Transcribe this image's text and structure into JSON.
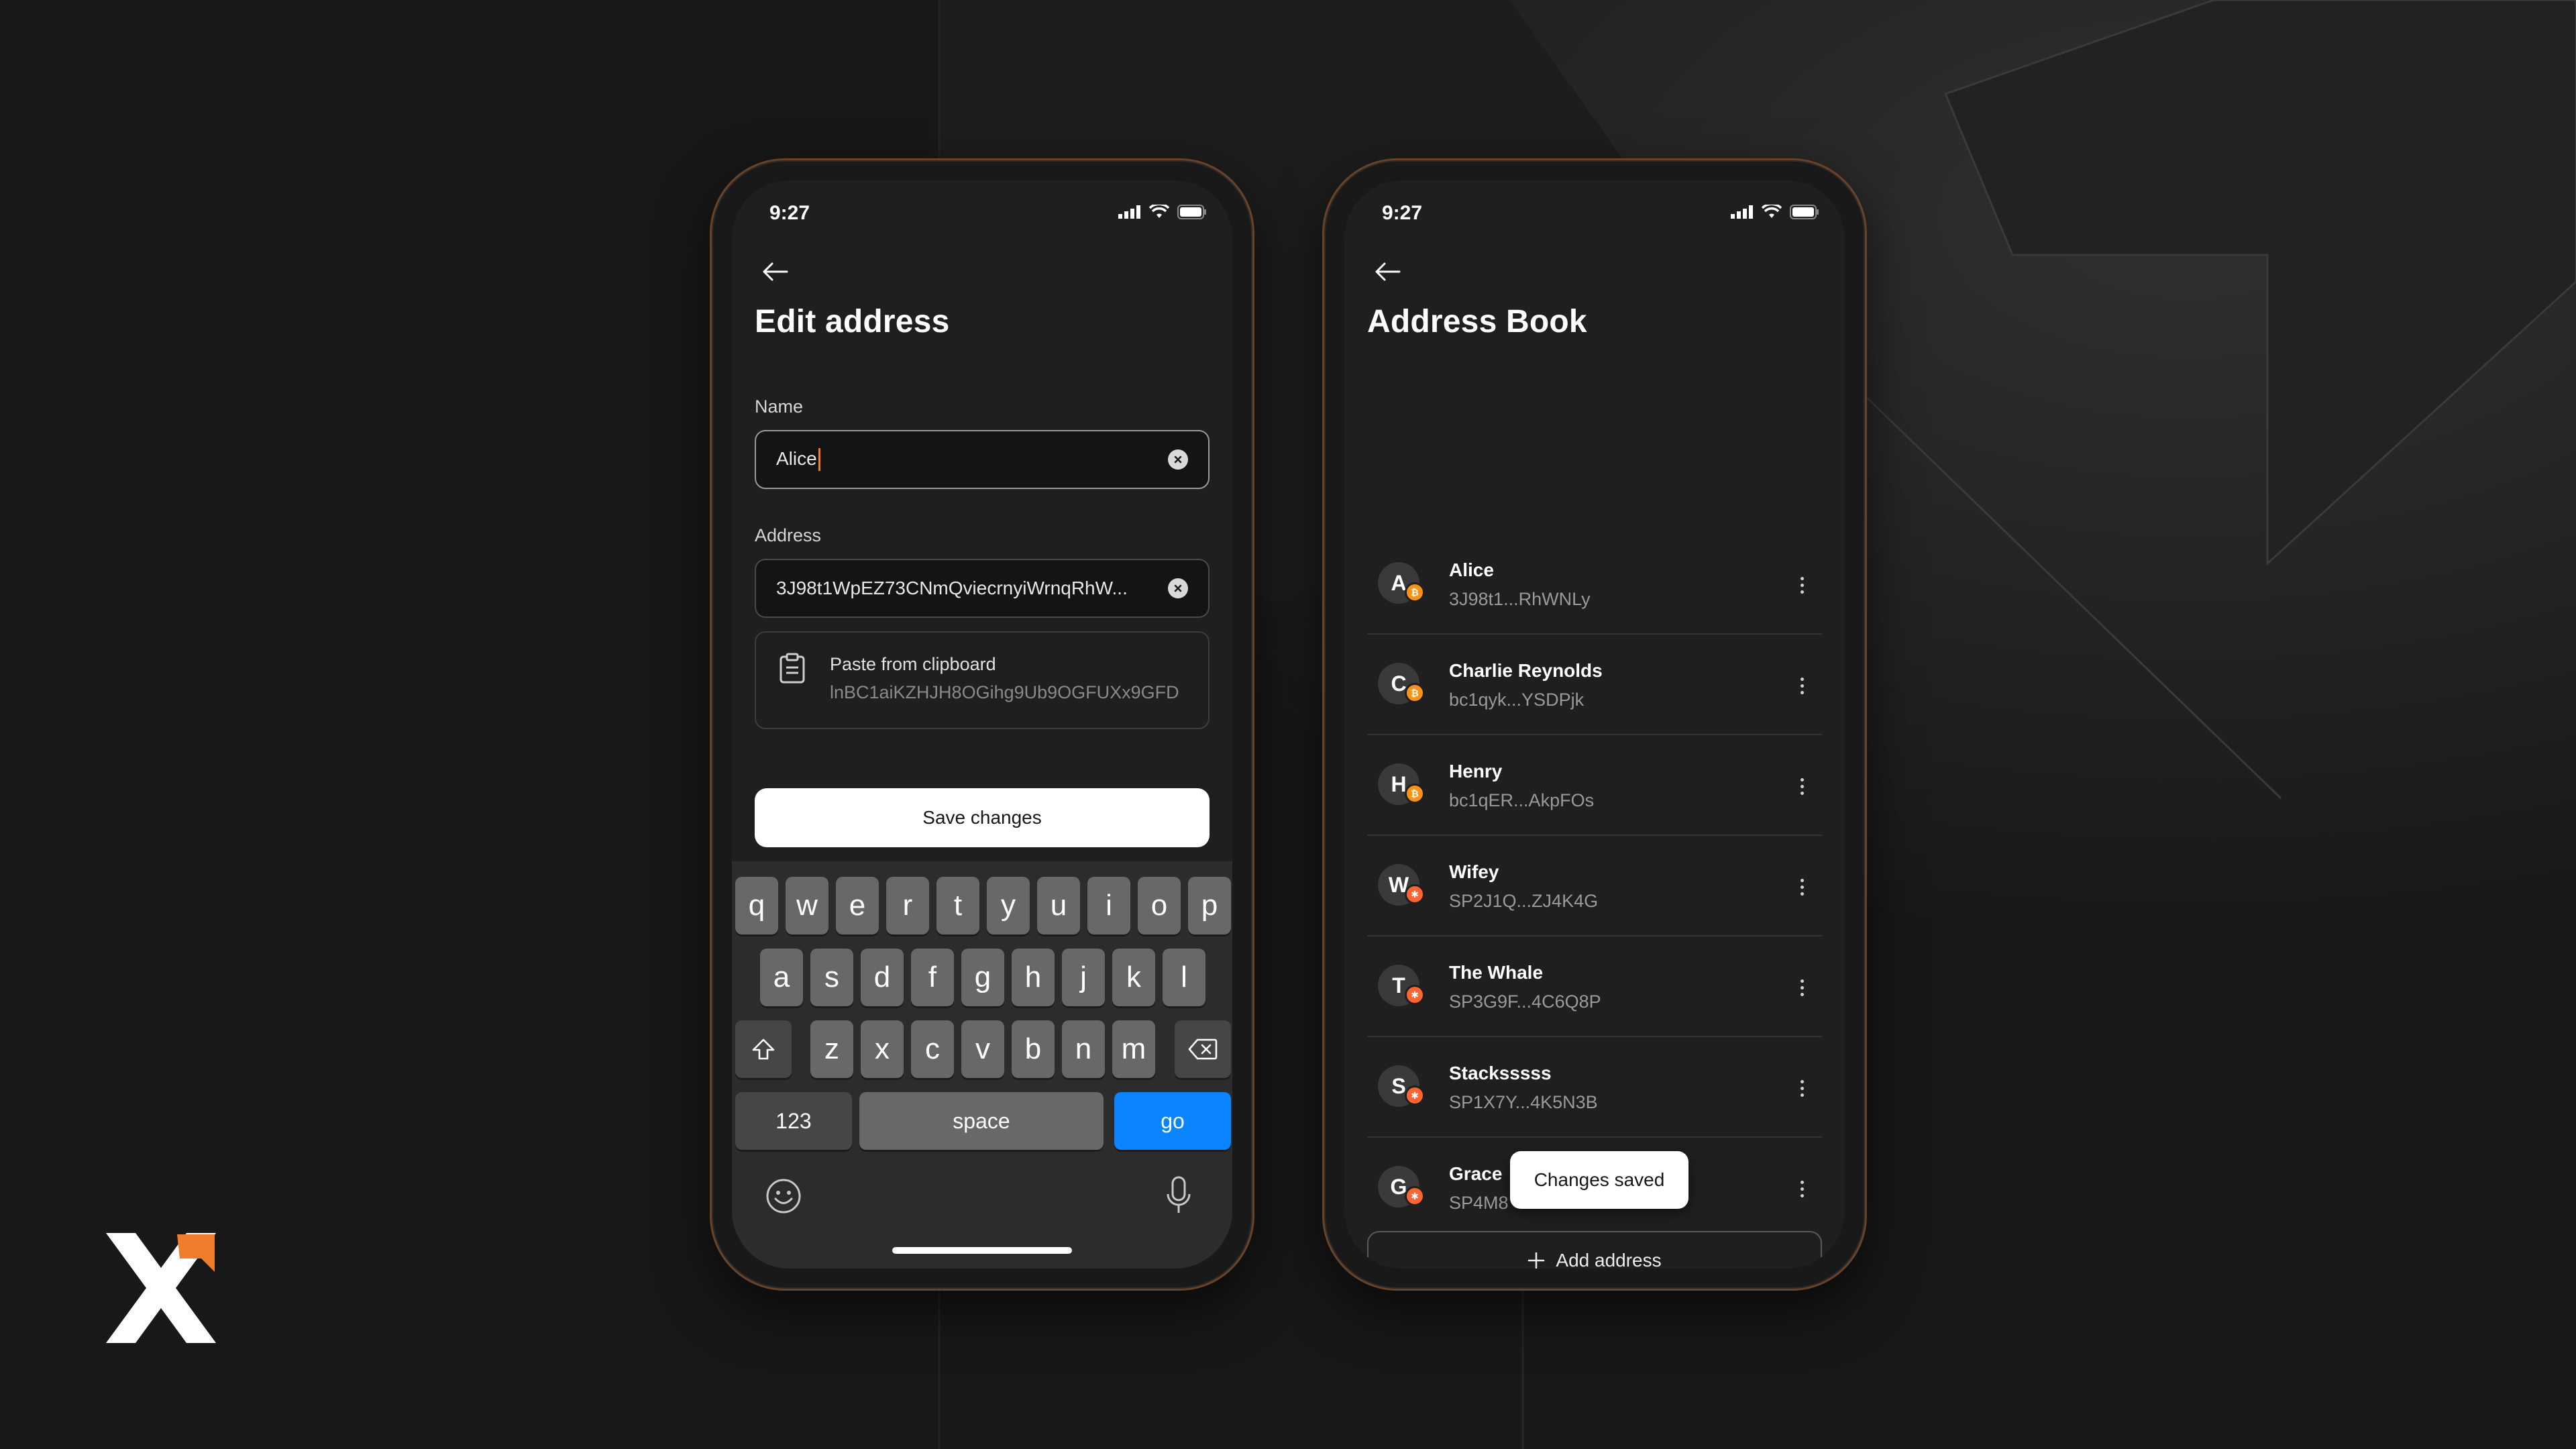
{
  "colors": {
    "background": "#181818",
    "phone_frame_accent": "#6a4228",
    "accent_orange": "#f07d2c",
    "keyboard_go": "#0a84ff",
    "btc": "#f7931a",
    "stx": "#fc6432"
  },
  "brand": {
    "logo_icon": "x-logo-icon"
  },
  "edit_screen": {
    "status_time": "9:27",
    "title": "Edit address",
    "name_label": "Name",
    "name_value": "Alice",
    "address_label": "Address",
    "address_value": "3J98t1WpEZ73CNmQviecrnyiWrnqRhW...",
    "clipboard_title": "Paste from clipboard",
    "clipboard_address": "lnBC1aiKZHJH8OGihg9Ub9OGFUXx9GFD",
    "save_label": "Save changes",
    "keyboard": {
      "row1": [
        "q",
        "w",
        "e",
        "r",
        "t",
        "y",
        "u",
        "i",
        "o",
        "p"
      ],
      "row2": [
        "a",
        "s",
        "d",
        "f",
        "g",
        "h",
        "j",
        "k",
        "l"
      ],
      "row3": [
        "z",
        "x",
        "c",
        "v",
        "b",
        "n",
        "m"
      ],
      "numbers_label": "123",
      "space_label": "space",
      "go_label": "go"
    }
  },
  "address_book": {
    "status_time": "9:27",
    "title": "Address Book",
    "contacts": [
      {
        "initial": "A",
        "name": "Alice",
        "address": "3J98t1...RhWNLy",
        "coin": "btc"
      },
      {
        "initial": "C",
        "name": "Charlie Reynolds",
        "address": "bc1qyk...YSDPjk",
        "coin": "btc"
      },
      {
        "initial": "H",
        "name": "Henry",
        "address": "bc1qER...AkpFOs",
        "coin": "btc"
      },
      {
        "initial": "W",
        "name": "Wifey",
        "address": "SP2J1Q...ZJ4K4G",
        "coin": "stx"
      },
      {
        "initial": "T",
        "name": "The Whale",
        "address": "SP3G9F...4C6Q8P",
        "coin": "stx"
      },
      {
        "initial": "S",
        "name": "Stacksssss",
        "address": "SP1X7Y...4K5N3B",
        "coin": "stx"
      },
      {
        "initial": "G",
        "name": "Grace",
        "address": "SP4M8",
        "coin": "stx"
      }
    ],
    "toast": "Changes saved",
    "add_label": "Add address",
    "tabs": [
      {
        "icon": "wallet-icon",
        "active": false
      },
      {
        "icon": "diamond-icon",
        "active": false
      },
      {
        "icon": "chart-icon",
        "active": false
      },
      {
        "icon": "globe-icon",
        "active": false
      },
      {
        "icon": "gear-icon",
        "active": true
      }
    ]
  }
}
